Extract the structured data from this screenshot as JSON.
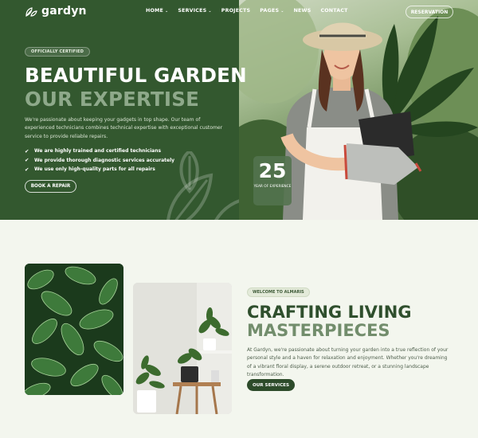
{
  "header": {
    "logo_text": "gardyn",
    "nav": [
      {
        "label": "HOME",
        "dropdown": true
      },
      {
        "label": "SERVICES",
        "dropdown": true
      },
      {
        "label": "PROJECTS",
        "dropdown": false
      },
      {
        "label": "PAGES",
        "dropdown": true
      },
      {
        "label": "NEWS",
        "dropdown": false
      },
      {
        "label": "CONTACT",
        "dropdown": false
      }
    ],
    "reservation_label": "RESERVATION"
  },
  "hero": {
    "badge": "OFFICIALLY CERTIFIED",
    "title_line1": "BEAUTIFUL GARDEN",
    "title_line2": "OUR EXPERTISE",
    "description": "We're passionate about keeping your gadgets in top shape. Our team of experienced technicians combines technical expertise with exceptional customer service to provide reliable repairs.",
    "checks": [
      "We are highly trained and certified technicians",
      "We provide thorough diagnostic services accurately",
      "We use only high-quality parts for all repairs"
    ],
    "book_label": "BOOK A REPAIR",
    "years_number": "25",
    "years_label": "YEAR OF EXPERIENCE"
  },
  "about": {
    "badge": "WELCOME TO ALMARIS",
    "title_line1": "CRAFTING LIVING",
    "title_line2": "MASTERPIECES",
    "description": "At Gardyn, we're passionate about turning your garden into a true reflection of your personal style and a haven for relaxation and enjoyment. Whether you're dreaming of a vibrant floral display, a serene outdoor retreat, or a stunning landscape transformation.",
    "services_label": "OUR SERVICES"
  },
  "colors": {
    "hero_green": "#33582f",
    "title_muted": "#8ea98a",
    "page_bg": "#f3f6ee",
    "button_dark": "#2d4b2a"
  },
  "icons": [
    "leaf-logo-icon",
    "chevron-down-icon",
    "check-icon",
    "leaf-decoration-icon"
  ]
}
